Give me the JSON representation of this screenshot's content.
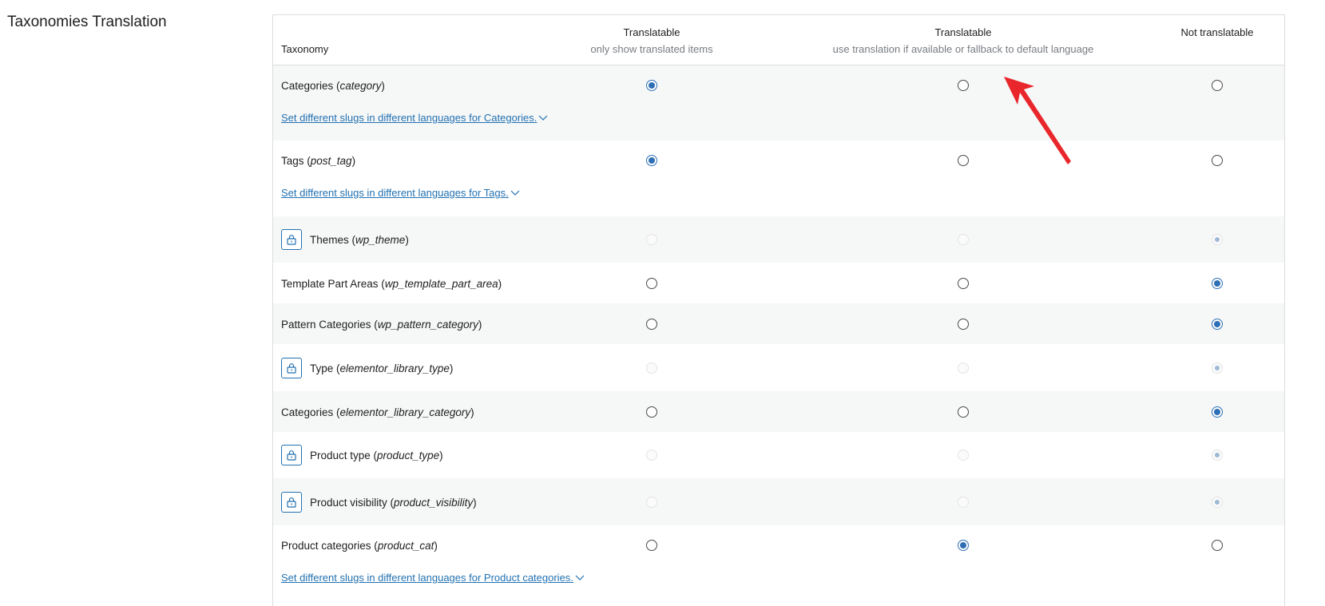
{
  "section": {
    "title": "Taxonomies Translation"
  },
  "table": {
    "headers": {
      "taxonomy": "Taxonomy",
      "col1_main": "Translatable",
      "col1_sub": "only show translated items",
      "col2_main": "Translatable",
      "col2_sub": "use translation if available or fallback to default language",
      "col3_main": "Not translatable"
    },
    "rows": [
      {
        "label": "Categories (",
        "slug": "category",
        "close": ")",
        "locked": false,
        "selected": 1,
        "slug_link": "Set different slugs in different languages for Categories."
      },
      {
        "label": "Tags (",
        "slug": "post_tag",
        "close": ")",
        "locked": false,
        "selected": 1,
        "slug_link": "Set different slugs in different languages for Tags."
      },
      {
        "label": "Themes (",
        "slug": "wp_theme",
        "close": ")",
        "locked": true,
        "selected": 3
      },
      {
        "label": "Template Part Areas (",
        "slug": "wp_template_part_area",
        "close": ")",
        "locked": false,
        "selected": 3
      },
      {
        "label": "Pattern Categories (",
        "slug": "wp_pattern_category",
        "close": ")",
        "locked": false,
        "selected": 3
      },
      {
        "label": "Type (",
        "slug": "elementor_library_type",
        "close": ")",
        "locked": true,
        "selected": 3
      },
      {
        "label": "Categories (",
        "slug": "elementor_library_category",
        "close": ")",
        "locked": false,
        "selected": 3
      },
      {
        "label": "Product type (",
        "slug": "product_type",
        "close": ")",
        "locked": true,
        "selected": 3
      },
      {
        "label": "Product visibility (",
        "slug": "product_visibility",
        "close": ")",
        "locked": true,
        "selected": 3
      },
      {
        "label": "Product categories (",
        "slug": "product_cat",
        "close": ")",
        "locked": false,
        "selected": 2,
        "slug_link": "Set different slugs in different languages for Product categories."
      }
    ]
  },
  "colors": {
    "accent": "#2271b1",
    "radio_checked": "#2f6fb5",
    "row_alt": "#f6f7f7",
    "annotation_arrow": "#e8262b"
  },
  "icons": {
    "lock": "lock-icon",
    "chevron": "chevron-down-icon",
    "annotation": "annotation-arrow"
  }
}
